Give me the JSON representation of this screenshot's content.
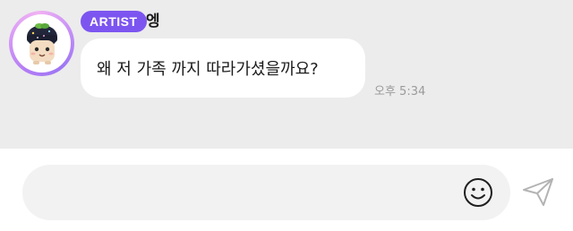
{
  "chat": {
    "sender": {
      "badge": "ARTIST",
      "name": "엥",
      "avatar_icon": "fan-character-avatar-icon"
    },
    "message": {
      "text": "왜 저 가족 까지 따라가셨을까요?",
      "timestamp": "오후 5:34"
    }
  },
  "composer": {
    "placeholder": "",
    "emoji_icon": "smiley-icon",
    "send_icon": "paper-plane-icon"
  },
  "colors": {
    "background": "#ececec",
    "badge": "#7c55f0",
    "bubble": "#ffffff",
    "timestamp": "#9a9a9a",
    "input_pill": "#f2f2f2"
  }
}
